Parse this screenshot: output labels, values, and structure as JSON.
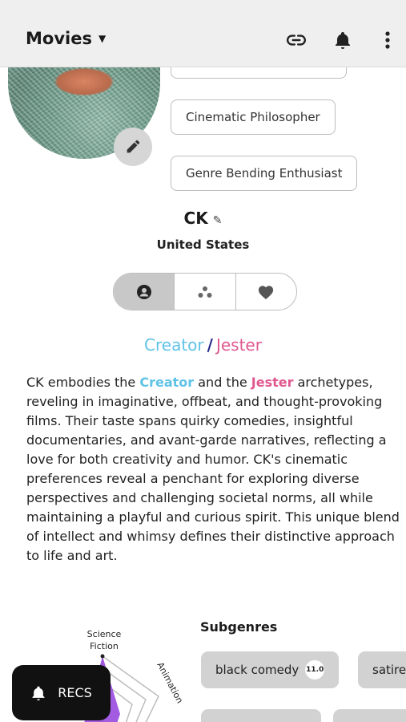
{
  "appbar": {
    "menu_label": "Movies",
    "caret_icon": "caret-down-icon",
    "icons": [
      "link-icon",
      "bell-icon",
      "more-vertical-icon"
    ]
  },
  "profile": {
    "tags": [
      "Cinematic Philosopher",
      "Genre Bending Enthusiast"
    ],
    "username": "CK",
    "location": "United States",
    "segments": [
      "person-icon",
      "cluster-icon",
      "heart-icon"
    ],
    "archetype_primary": "Creator",
    "archetype_secondary": "Jester",
    "bio_prefix": "CK embodies the ",
    "bio_mid": " and the ",
    "bio_suffix": " archetypes, reveling in imaginative, offbeat, and thought-provoking films. Their taste spans quirky comedies, insightful documentaries, and avant-garde narratives, reflecting a love for both creativity and humor. CK's cinematic preferences reveal a penchant for exploring diverse perspectives and challenging societal norms, all while maintaining a playful and curious spirit. This unique blend of intellect and whimsy defines their distinctive approach to life and art."
  },
  "radar": {
    "label_top": "Science Fiction",
    "label_right": "Animation"
  },
  "subgenres": {
    "title": "Subgenres",
    "chips": [
      {
        "label": "black comedy",
        "score": "11.0"
      },
      {
        "label": "satire",
        "score": ""
      }
    ]
  },
  "recs_button": {
    "label": "RECS"
  },
  "colors": {
    "creator": "#5ec3e6",
    "jester": "#e0578f",
    "slash": "#262a8a",
    "radar_fill": "#9b4de0"
  }
}
